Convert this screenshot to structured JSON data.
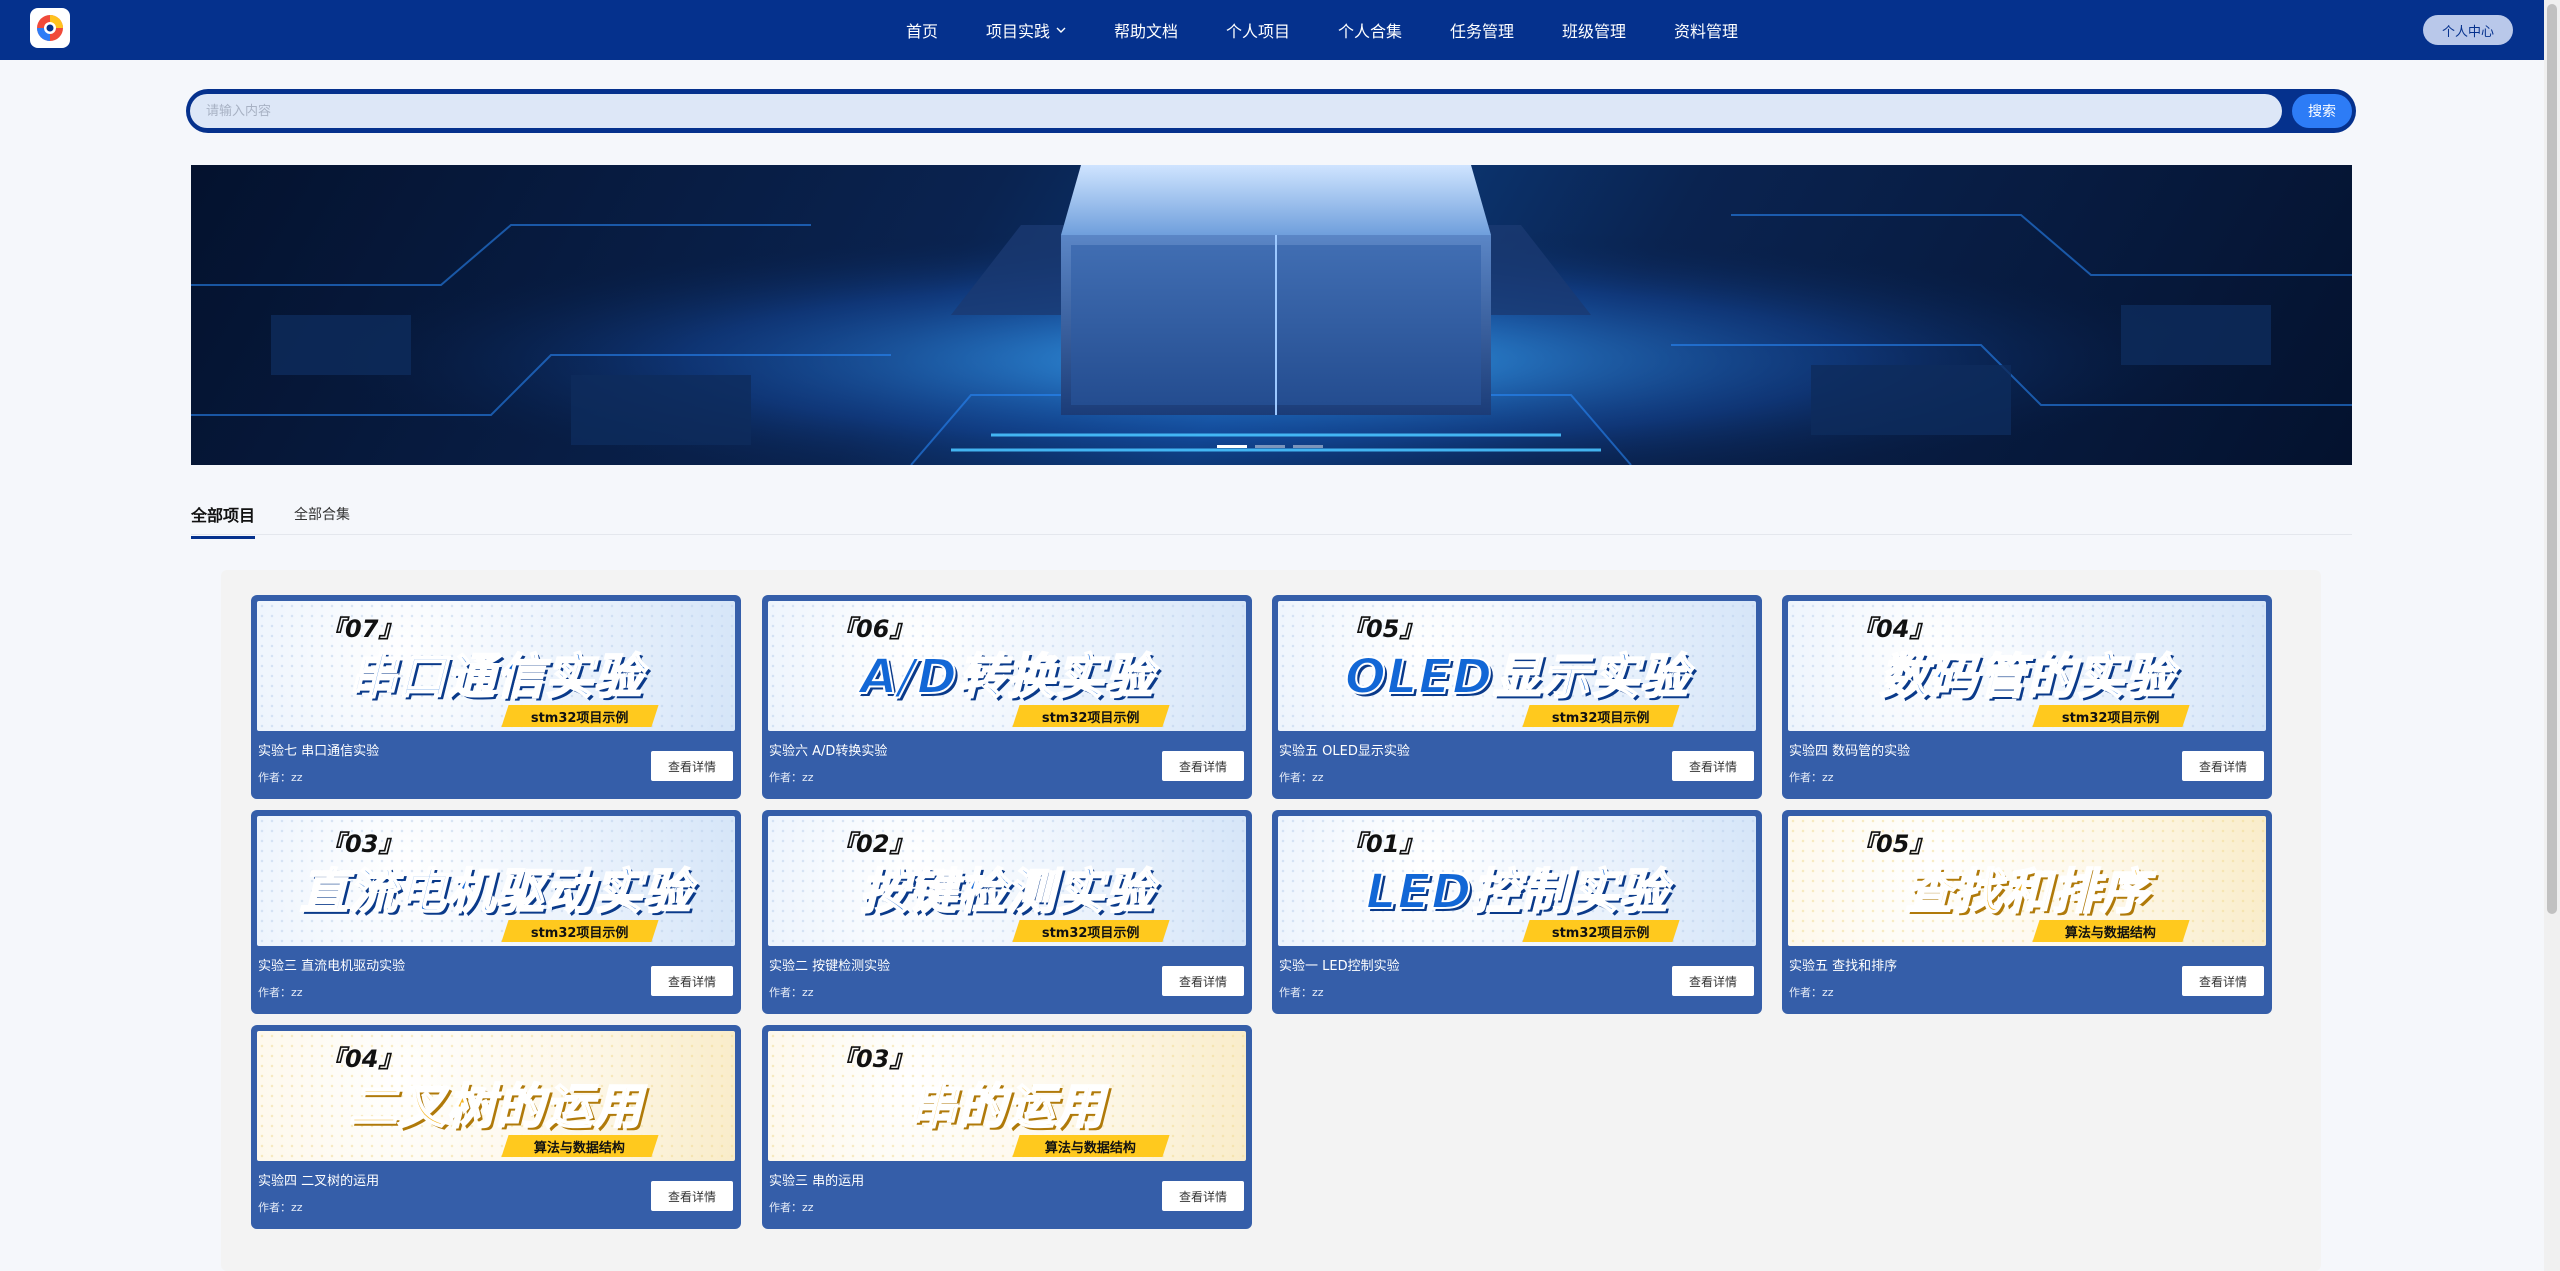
{
  "nav": {
    "items": [
      {
        "label": "首页"
      },
      {
        "label": "项目实践",
        "dropdown": true
      },
      {
        "label": "帮助文档"
      },
      {
        "label": "个人项目"
      },
      {
        "label": "个人合集"
      },
      {
        "label": "任务管理"
      },
      {
        "label": "班级管理"
      },
      {
        "label": "资料管理"
      }
    ],
    "personal_center": "个人中心"
  },
  "search": {
    "placeholder": "请输入内容",
    "button": "搜索"
  },
  "banner": {
    "slides": 3,
    "active": 0
  },
  "tabs": [
    {
      "label": "全部项目",
      "active": true
    },
    {
      "label": "全部合集",
      "active": false
    }
  ],
  "card_detail_label": "查看详情",
  "cards": [
    {
      "num": "『07』",
      "image_title": "串口通信实验",
      "tag": "stm32项目示例",
      "theme": "blue",
      "title": "实验七 串口通信实验",
      "author": "作者：zz"
    },
    {
      "num": "『06』",
      "image_title": "A/D转换实验",
      "tag": "stm32项目示例",
      "theme": "blue",
      "title": "实验六 A/D转换实验",
      "author": "作者：zz"
    },
    {
      "num": "『05』",
      "image_title": "OLED显示实验",
      "tag": "stm32项目示例",
      "theme": "blue",
      "title": "实验五 OLED显示实验",
      "author": "作者：zz"
    },
    {
      "num": "『04』",
      "image_title": "数码管的实验",
      "tag": "stm32项目示例",
      "theme": "blue",
      "title": "实验四 数码管的实验",
      "author": "作者：zz"
    },
    {
      "num": "『03』",
      "image_title": "直流电机驱动实验",
      "tag": "stm32项目示例",
      "theme": "blue",
      "title": "实验三 直流电机驱动实验",
      "author": "作者：zz"
    },
    {
      "num": "『02』",
      "image_title": "按键检测实验",
      "tag": "stm32项目示例",
      "theme": "blue",
      "title": "实验二 按键检测实验",
      "author": "作者：zz"
    },
    {
      "num": "『01』",
      "image_title": "LED控制实验",
      "tag": "stm32项目示例",
      "theme": "blue",
      "title": "实验一 LED控制实验",
      "author": "作者：zz"
    },
    {
      "num": "『05』",
      "image_title": "查找和排序",
      "tag": "算法与数据结构",
      "theme": "yellow",
      "title": "实验五 查找和排序",
      "author": "作者：zz"
    },
    {
      "num": "『04』",
      "image_title": "二叉树的运用",
      "tag": "算法与数据结构",
      "theme": "yellow",
      "title": "实验四 二叉树的运用",
      "author": "作者：zz"
    },
    {
      "num": "『03』",
      "image_title": "串的运用",
      "tag": "算法与数据结构",
      "theme": "yellow",
      "title": "实验三 串的运用",
      "author": "作者：zz"
    }
  ]
}
